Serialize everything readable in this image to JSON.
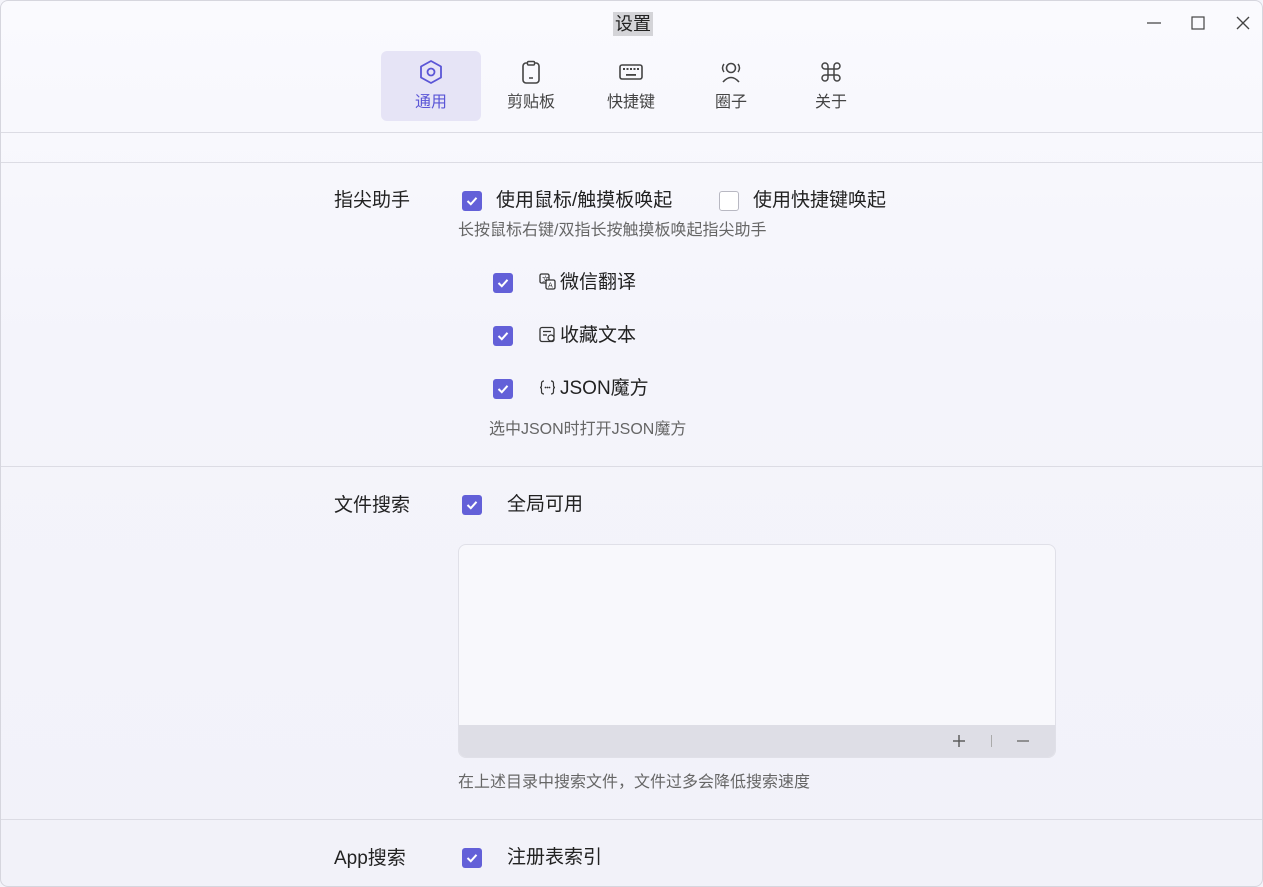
{
  "window": {
    "title": "设置"
  },
  "tabs": [
    {
      "label": "通用",
      "icon": "hexagon-settings-icon"
    },
    {
      "label": "剪贴板",
      "icon": "clipboard-icon"
    },
    {
      "label": "快捷键",
      "icon": "keyboard-icon"
    },
    {
      "label": "圈子",
      "icon": "group-icon"
    },
    {
      "label": "关于",
      "icon": "command-icon"
    }
  ],
  "active_tab": "通用",
  "fingertip": {
    "label": "指尖助手",
    "option_mouse": "使用鼠标/触摸板唤起",
    "option_mouse_checked": true,
    "option_hotkey": "使用快捷键唤起",
    "option_hotkey_checked": false,
    "hint": "长按鼠标右键/双指长按触摸板唤起指尖助手",
    "tools": [
      {
        "label": "微信翻译",
        "icon": "translate-icon",
        "checked": true
      },
      {
        "label": "收藏文本",
        "icon": "bookmark-text-icon",
        "checked": true
      },
      {
        "label": "JSON魔方",
        "icon": "json-braces-icon",
        "checked": true
      }
    ],
    "tools_hint": "选中JSON时打开JSON魔方"
  },
  "file_search": {
    "label": "文件搜索",
    "option": "全局可用",
    "option_checked": true,
    "add_symbol": "+",
    "remove_symbol": "−",
    "hint": "在上述目录中搜索文件，文件过多会降低搜索速度"
  },
  "app_search": {
    "label": "App搜索",
    "option": "注册表索引",
    "option_checked": true
  },
  "colors": {
    "accent": "#6360d8",
    "active_tab_bg": "#e6e4f6"
  }
}
